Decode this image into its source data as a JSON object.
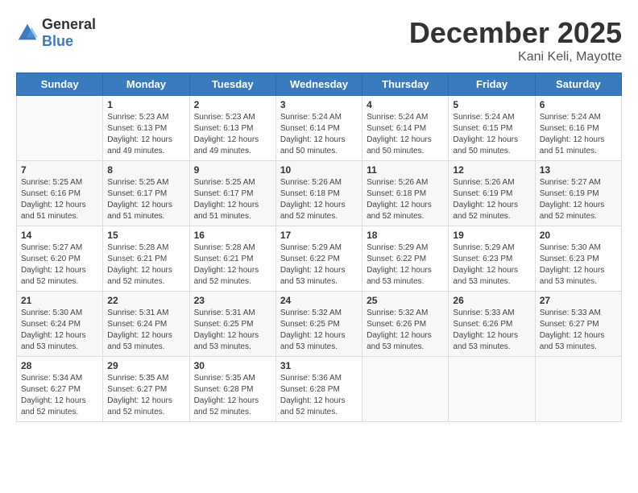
{
  "header": {
    "logo_general": "General",
    "logo_blue": "Blue",
    "month_title": "December 2025",
    "location": "Kani Keli, Mayotte"
  },
  "days_of_week": [
    "Sunday",
    "Monday",
    "Tuesday",
    "Wednesday",
    "Thursday",
    "Friday",
    "Saturday"
  ],
  "weeks": [
    [
      {
        "day": "",
        "info": ""
      },
      {
        "day": "1",
        "info": "Sunrise: 5:23 AM\nSunset: 6:13 PM\nDaylight: 12 hours\nand 49 minutes."
      },
      {
        "day": "2",
        "info": "Sunrise: 5:23 AM\nSunset: 6:13 PM\nDaylight: 12 hours\nand 49 minutes."
      },
      {
        "day": "3",
        "info": "Sunrise: 5:24 AM\nSunset: 6:14 PM\nDaylight: 12 hours\nand 50 minutes."
      },
      {
        "day": "4",
        "info": "Sunrise: 5:24 AM\nSunset: 6:14 PM\nDaylight: 12 hours\nand 50 minutes."
      },
      {
        "day": "5",
        "info": "Sunrise: 5:24 AM\nSunset: 6:15 PM\nDaylight: 12 hours\nand 50 minutes."
      },
      {
        "day": "6",
        "info": "Sunrise: 5:24 AM\nSunset: 6:16 PM\nDaylight: 12 hours\nand 51 minutes."
      }
    ],
    [
      {
        "day": "7",
        "info": "Sunrise: 5:25 AM\nSunset: 6:16 PM\nDaylight: 12 hours\nand 51 minutes."
      },
      {
        "day": "8",
        "info": "Sunrise: 5:25 AM\nSunset: 6:17 PM\nDaylight: 12 hours\nand 51 minutes."
      },
      {
        "day": "9",
        "info": "Sunrise: 5:25 AM\nSunset: 6:17 PM\nDaylight: 12 hours\nand 51 minutes."
      },
      {
        "day": "10",
        "info": "Sunrise: 5:26 AM\nSunset: 6:18 PM\nDaylight: 12 hours\nand 52 minutes."
      },
      {
        "day": "11",
        "info": "Sunrise: 5:26 AM\nSunset: 6:18 PM\nDaylight: 12 hours\nand 52 minutes."
      },
      {
        "day": "12",
        "info": "Sunrise: 5:26 AM\nSunset: 6:19 PM\nDaylight: 12 hours\nand 52 minutes."
      },
      {
        "day": "13",
        "info": "Sunrise: 5:27 AM\nSunset: 6:19 PM\nDaylight: 12 hours\nand 52 minutes."
      }
    ],
    [
      {
        "day": "14",
        "info": "Sunrise: 5:27 AM\nSunset: 6:20 PM\nDaylight: 12 hours\nand 52 minutes."
      },
      {
        "day": "15",
        "info": "Sunrise: 5:28 AM\nSunset: 6:21 PM\nDaylight: 12 hours\nand 52 minutes."
      },
      {
        "day": "16",
        "info": "Sunrise: 5:28 AM\nSunset: 6:21 PM\nDaylight: 12 hours\nand 52 minutes."
      },
      {
        "day": "17",
        "info": "Sunrise: 5:29 AM\nSunset: 6:22 PM\nDaylight: 12 hours\nand 53 minutes."
      },
      {
        "day": "18",
        "info": "Sunrise: 5:29 AM\nSunset: 6:22 PM\nDaylight: 12 hours\nand 53 minutes."
      },
      {
        "day": "19",
        "info": "Sunrise: 5:29 AM\nSunset: 6:23 PM\nDaylight: 12 hours\nand 53 minutes."
      },
      {
        "day": "20",
        "info": "Sunrise: 5:30 AM\nSunset: 6:23 PM\nDaylight: 12 hours\nand 53 minutes."
      }
    ],
    [
      {
        "day": "21",
        "info": "Sunrise: 5:30 AM\nSunset: 6:24 PM\nDaylight: 12 hours\nand 53 minutes."
      },
      {
        "day": "22",
        "info": "Sunrise: 5:31 AM\nSunset: 6:24 PM\nDaylight: 12 hours\nand 53 minutes."
      },
      {
        "day": "23",
        "info": "Sunrise: 5:31 AM\nSunset: 6:25 PM\nDaylight: 12 hours\nand 53 minutes."
      },
      {
        "day": "24",
        "info": "Sunrise: 5:32 AM\nSunset: 6:25 PM\nDaylight: 12 hours\nand 53 minutes."
      },
      {
        "day": "25",
        "info": "Sunrise: 5:32 AM\nSunset: 6:26 PM\nDaylight: 12 hours\nand 53 minutes."
      },
      {
        "day": "26",
        "info": "Sunrise: 5:33 AM\nSunset: 6:26 PM\nDaylight: 12 hours\nand 53 minutes."
      },
      {
        "day": "27",
        "info": "Sunrise: 5:33 AM\nSunset: 6:27 PM\nDaylight: 12 hours\nand 53 minutes."
      }
    ],
    [
      {
        "day": "28",
        "info": "Sunrise: 5:34 AM\nSunset: 6:27 PM\nDaylight: 12 hours\nand 52 minutes."
      },
      {
        "day": "29",
        "info": "Sunrise: 5:35 AM\nSunset: 6:27 PM\nDaylight: 12 hours\nand 52 minutes."
      },
      {
        "day": "30",
        "info": "Sunrise: 5:35 AM\nSunset: 6:28 PM\nDaylight: 12 hours\nand 52 minutes."
      },
      {
        "day": "31",
        "info": "Sunrise: 5:36 AM\nSunset: 6:28 PM\nDaylight: 12 hours\nand 52 minutes."
      },
      {
        "day": "",
        "info": ""
      },
      {
        "day": "",
        "info": ""
      },
      {
        "day": "",
        "info": ""
      }
    ]
  ]
}
